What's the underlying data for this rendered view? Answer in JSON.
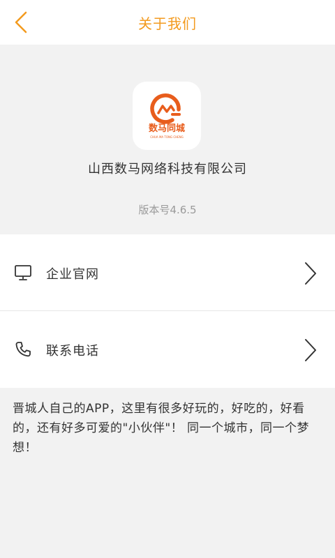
{
  "header": {
    "title": "关于我们"
  },
  "about": {
    "logo_text": "数马同城",
    "logo_subtext": "CHUA MA TONG CHENG",
    "company_name": "山西数马网络科技有限公司",
    "version": "版本号4.6.5"
  },
  "menu": {
    "items": [
      {
        "label": "企业官网",
        "icon": "monitor-icon"
      },
      {
        "label": "联系电话",
        "icon": "phone-icon"
      }
    ]
  },
  "description": "晋城人自己的APP，这里有很多好玩的，好吃的，好看的，还有好多可爱的\"小伙伴\"！ 同一个城市，同一个梦想！",
  "colors": {
    "accent": "#f39a1e",
    "logo_orange": "#e85d1c",
    "background": "#f2f2f2"
  }
}
